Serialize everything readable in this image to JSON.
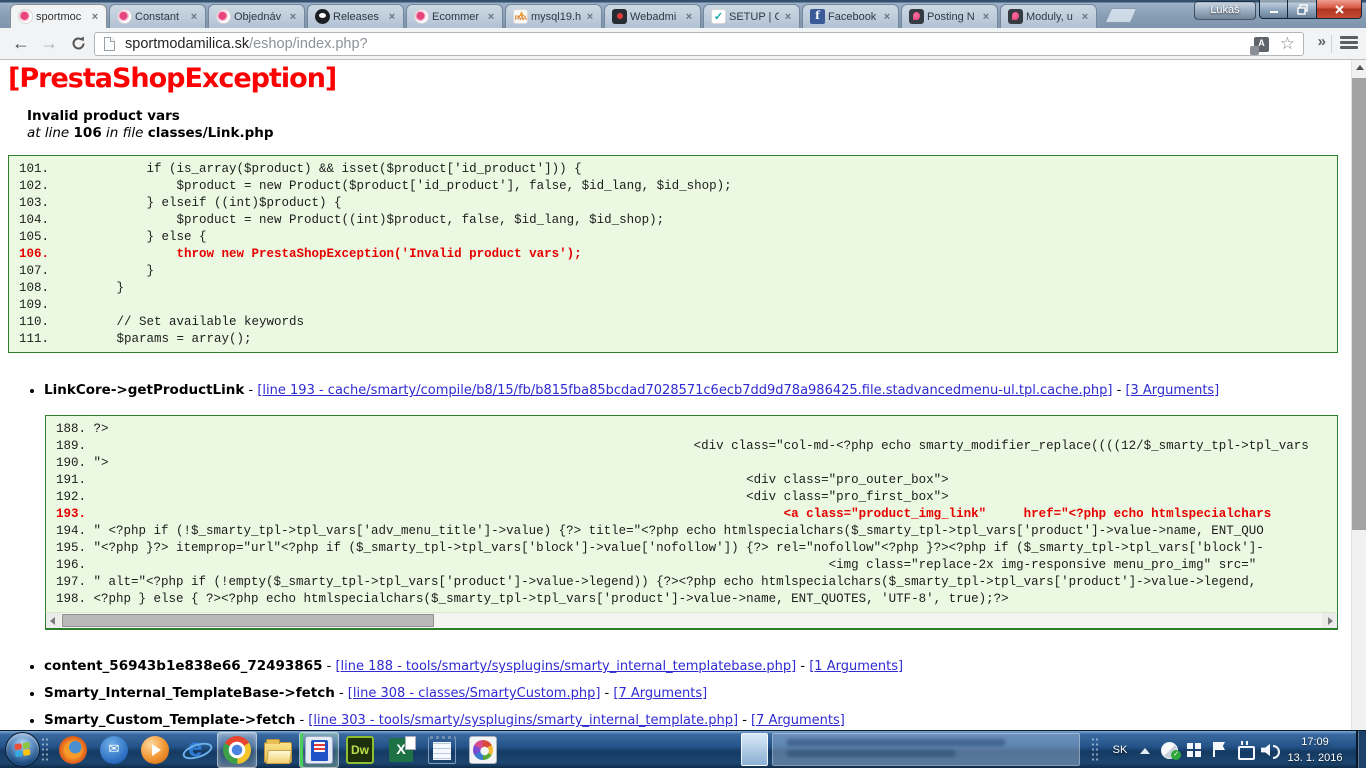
{
  "browser": {
    "tabs": [
      {
        "label": "sportmoc",
        "icon": "ps",
        "active": true
      },
      {
        "label": "Constant",
        "icon": "ps",
        "active": false
      },
      {
        "label": "Objednáv",
        "icon": "ps",
        "active": false
      },
      {
        "label": "Releases",
        "icon": "github",
        "active": false
      },
      {
        "label": "Ecommer",
        "icon": "ps",
        "active": false
      },
      {
        "label": "mysql19.h",
        "icon": "pma",
        "active": false
      },
      {
        "label": "Webadmi",
        "icon": "webadmin",
        "active": false
      },
      {
        "label": "SETUP | C",
        "icon": "setup",
        "active": false
      },
      {
        "label": "Facebook",
        "icon": "fb",
        "active": false
      },
      {
        "label": "Posting N",
        "icon": "psdark",
        "active": false
      },
      {
        "label": "Moduly, u",
        "icon": "psdark",
        "active": false
      }
    ],
    "profile_name": "Lukáš",
    "url_host": "sportmodamilica.sk",
    "url_path": "/eshop/index.php?"
  },
  "page": {
    "exception_title": "[PrestaShopException]",
    "error_name": "Invalid product vars",
    "at_line_label": "at line",
    "line_number": "106",
    "in_file_label": "in file",
    "file_name": "classes/Link.php",
    "separator": "-",
    "code_blocks": [
      {
        "lines": [
          {
            "t": "101.             if (is_array($product) && isset($product['id_product'])) {",
            "err": false
          },
          {
            "t": "102.                 $product = new Product($product['id_product'], false, $id_lang, $id_shop);",
            "err": false
          },
          {
            "t": "103.             } elseif ((int)$product) {",
            "err": false
          },
          {
            "t": "104.                 $product = new Product((int)$product, false, $id_lang, $id_shop);",
            "err": false
          },
          {
            "t": "105.             } else {",
            "err": false
          },
          {
            "t": "106.                 throw new PrestaShopException('Invalid product vars');",
            "err": true
          },
          {
            "t": "107.             }",
            "err": false
          },
          {
            "t": "108.         }",
            "err": false
          },
          {
            "t": "109.",
            "err": false
          },
          {
            "t": "110.         // Set available keywords",
            "err": false
          },
          {
            "t": "111.         $params = array();",
            "err": false
          }
        ]
      },
      {
        "lines": [
          {
            "t": "188. ?>",
            "err": false
          },
          {
            "t": "189.                                                                                 <div class=\"col-md-<?php echo smarty_modifier_replace((((12/$_smarty_tpl->tpl_vars",
            "err": false
          },
          {
            "t": "190. \">",
            "err": false
          },
          {
            "t": "191.                                                                                        <div class=\"pro_outer_box\">",
            "err": false
          },
          {
            "t": "192.                                                                                        <div class=\"pro_first_box\">",
            "err": false
          },
          {
            "t": "193.                                                                                             <a class=\"product_img_link\"     href=\"<?php echo htmlspecialchars",
            "err": true
          },
          {
            "t": "194. \" <?php if (!$_smarty_tpl->tpl_vars['adv_menu_title']->value) {?> title=\"<?php echo htmlspecialchars($_smarty_tpl->tpl_vars['product']->value->name, ENT_QUO",
            "err": false
          },
          {
            "t": "195. \"<?php }?> itemprop=\"url\"<?php if ($_smarty_tpl->tpl_vars['block']->value['nofollow']) {?> rel=\"nofollow\"<?php }?><?php if ($_smarty_tpl->tpl_vars['block']-",
            "err": false
          },
          {
            "t": "196.                                                                                                   <img class=\"replace-2x img-responsive menu_pro_img\" src=\"",
            "err": false
          },
          {
            "t": "197. \" alt=\"<?php if (!empty($_smarty_tpl->tpl_vars['product']->value->legend)) {?><?php echo htmlspecialchars($_smarty_tpl->tpl_vars['product']->value->legend,",
            "err": false
          },
          {
            "t": "198. <?php } else { ?><?php echo htmlspecialchars($_smarty_tpl->tpl_vars['product']->value->name, ENT_QUOTES, 'UTF-8', true);?>",
            "err": false
          }
        ]
      }
    ],
    "stack": [
      {
        "fn": "LinkCore->getProductLink",
        "loc": "[line 193 - cache/smarty/compile/b8/15/fb/b815fba85bcdad7028571c6ecb7dd9d78a986425.file.stadvancedmenu-ul.tpl.cache.php]",
        "args": "[3 Arguments]"
      },
      {
        "fn": "content_56943b1e838e66_72493865",
        "loc": "[line 188 - tools/smarty/sysplugins/smarty_internal_templatebase.php]",
        "args": "[1 Arguments]"
      },
      {
        "fn": "Smarty_Internal_TemplateBase->fetch",
        "loc": "[line 308 - classes/SmartyCustom.php]",
        "args": "[7 Arguments]"
      },
      {
        "fn": "Smarty_Custom_Template->fetch",
        "loc": "[line 303 - tools/smarty/sysplugins/smarty_internal_template.php]",
        "args": "[7 Arguments]"
      }
    ],
    "colors": {
      "error_red": "#e60000",
      "code_bg": "#ebf9e2",
      "code_border": "#2c7f2c",
      "link_blue": "#2f2ad2"
    }
  },
  "taskbar": {
    "apps": [
      {
        "name": "firefox",
        "active": false
      },
      {
        "name": "thunderbird",
        "active": false
      },
      {
        "name": "wmp",
        "active": false
      },
      {
        "name": "ie",
        "active": false
      },
      {
        "name": "chrome",
        "active": true
      },
      {
        "name": "explorer",
        "active": false
      },
      {
        "name": "floppy",
        "active": true,
        "attention": true
      },
      {
        "name": "dreamweaver",
        "active": false
      },
      {
        "name": "excel",
        "active": false
      },
      {
        "name": "notepad",
        "active": false
      },
      {
        "name": "paint",
        "active": false
      }
    ],
    "tray": {
      "language": "SK",
      "icons": [
        "system-update",
        "network-places",
        "action-center",
        "power",
        "volume"
      ],
      "time": "17:09",
      "date": "13. 1. 2016"
    }
  }
}
